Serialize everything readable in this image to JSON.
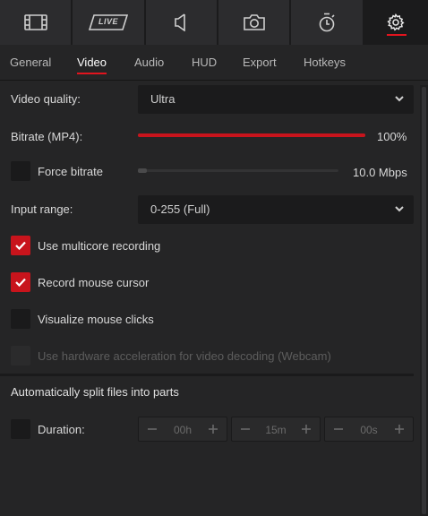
{
  "toolbar": {
    "icons": [
      "film-icon",
      "live-icon",
      "audio-icon",
      "camera-icon",
      "timer-icon",
      "gear-icon"
    ],
    "live_label": "LIVE"
  },
  "tabs": [
    {
      "label": "General"
    },
    {
      "label": "Video"
    },
    {
      "label": "Audio"
    },
    {
      "label": "HUD"
    },
    {
      "label": "Export"
    },
    {
      "label": "Hotkeys"
    }
  ],
  "active_tab": "Video",
  "video": {
    "quality_label": "Video quality:",
    "quality_value": "Ultra",
    "bitrate_label": "Bitrate (MP4):",
    "bitrate_percent": 100,
    "bitrate_text": "100%",
    "force_bitrate_label": "Force bitrate",
    "force_bitrate_checked": false,
    "force_bitrate_value": "10.0 Mbps",
    "input_range_label": "Input range:",
    "input_range_value": "0-255 (Full)",
    "multicore_label": "Use multicore recording",
    "multicore_checked": true,
    "mouse_cursor_label": "Record mouse cursor",
    "mouse_cursor_checked": true,
    "mouse_clicks_label": "Visualize mouse clicks",
    "mouse_clicks_checked": false,
    "hw_accel_label": "Use hardware acceleration for video decoding (Webcam)",
    "hw_accel_enabled": false
  },
  "split": {
    "title": "Automatically split files into parts",
    "duration_label": "Duration:",
    "duration_checked": false,
    "hours": "00h",
    "minutes": "15m",
    "seconds": "00s"
  },
  "colors": {
    "accent": "#e1141e",
    "background": "#252526",
    "field": "#1b1b1c"
  }
}
